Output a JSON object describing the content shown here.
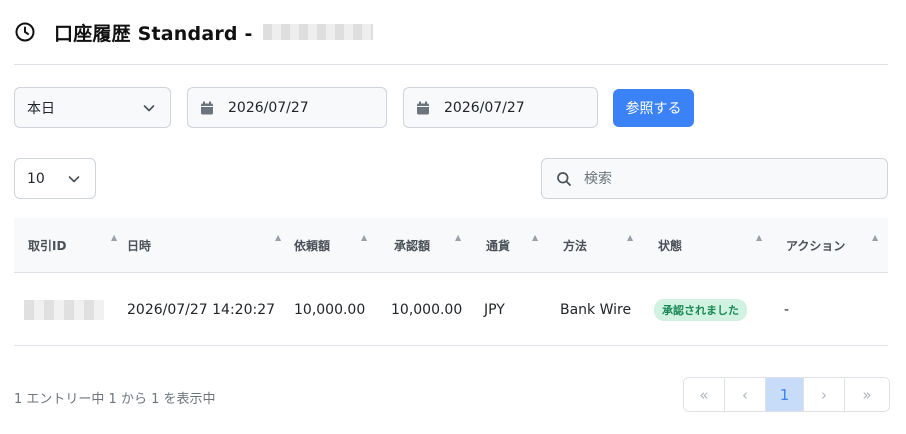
{
  "header": {
    "title": "口座履歴 Standard -"
  },
  "filters": {
    "period": "本日",
    "start_date": "2026/07/27",
    "end_date": "2026/07/27",
    "submit_label": "参照する"
  },
  "table_controls": {
    "per_page": "10",
    "search_placeholder": "検索"
  },
  "table": {
    "columns": [
      "取引ID",
      "日時",
      "依頼額",
      "承認額",
      "通貨",
      "方法",
      "状態",
      "アクション"
    ],
    "rows": [
      {
        "datetime": "2026/07/27 14:20:27",
        "requested": "10,000.00",
        "approved": "10,000.00",
        "currency": "JPY",
        "method": "Bank Wire",
        "status": "承認されました",
        "action": "-"
      }
    ]
  },
  "footer": {
    "info": "1 エントリー中 1 から 1 を表示中",
    "pagination": {
      "first": "«",
      "prev": "‹",
      "current": "1",
      "next": "›",
      "last": "»"
    }
  },
  "colors": {
    "primary": "#3b82f6",
    "success_badge_bg": "#d1f2e0",
    "success_badge_text": "#198754"
  }
}
